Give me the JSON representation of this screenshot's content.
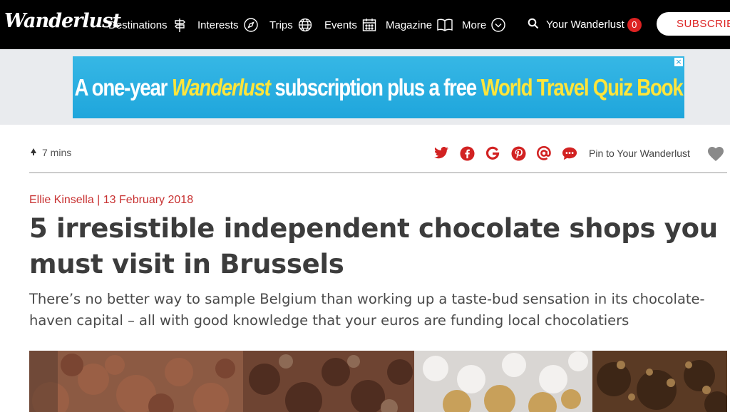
{
  "nav": {
    "logo": "Wanderlust",
    "items": [
      {
        "label": "Destinations",
        "icon": "signpost-icon"
      },
      {
        "label": "Interests",
        "icon": "compass-icon"
      },
      {
        "label": "Trips",
        "icon": "globe-icon"
      },
      {
        "label": "Events",
        "icon": "calendar-icon"
      },
      {
        "label": "Magazine",
        "icon": "book-icon"
      },
      {
        "label": "More",
        "icon": "chevron-down-circle-icon"
      }
    ],
    "account_label": "Your Wanderlust",
    "account_count": "0",
    "subscribe_label": "SUBSCRIBE"
  },
  "ad": {
    "part1": "A one-year",
    "part2": "Wanderlust",
    "part3": "subscription plus a free",
    "part4": "World Travel Quiz Book",
    "close": "×"
  },
  "meta": {
    "read_time": "7 mins",
    "share_icons": [
      "twitter-icon",
      "facebook-icon",
      "google-plus-icon",
      "pinterest-icon",
      "email-icon",
      "comment-icon"
    ],
    "pin_label": "Pin to Your Wanderlust"
  },
  "article": {
    "author": "Ellie Kinsella",
    "separator": "|",
    "date": "13 February 2018",
    "title": "5 irresistible independent chocolate shops you must visit in Brussels",
    "standfirst": "There’s no better way to sample Belgium than working up a taste-bud sensation in its chocolate-haven capital – all with good knowledge that your euros are funding local chocolatiers"
  },
  "colors": {
    "nav_bg": "#000000",
    "accent_red": "#d22222",
    "byline_red": "#c83232",
    "ad_blue": "#1fa6dc",
    "ad_yellow": "#ffe53a"
  }
}
